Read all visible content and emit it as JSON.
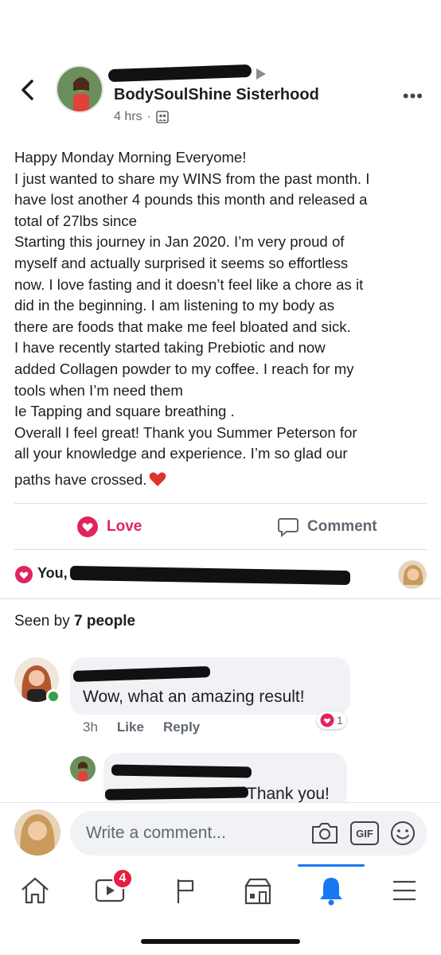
{
  "header": {
    "group_name": "BodySoulShine Sisterhood",
    "time": "4 hrs",
    "separator": "·"
  },
  "post": {
    "lines": [
      "Happy Monday Morning Everyome!",
      "I just wanted to share my WINS from the past month. I",
      "have lost another 4 pounds this month and released a",
      "total of 27lbs since",
      "Starting this journey in Jan 2020. I’m very proud of",
      "myself and actually surprised it seems so effortless",
      "now. I love fasting and it doesn’t feel like a chore as it",
      "did in the beginning. I am listening to my body as",
      "there are foods that make me feel bloated and sick.",
      "I have recently started taking Prebiotic and now",
      "added  Collagen powder to my coffee. I reach for my",
      "tools when I’m need them",
      "Ie Tapping and square breathing .",
      "Overall I feel great! Thank you Summer Peterson for",
      "all your knowledge and experience.  I’m so glad our",
      "paths have crossed."
    ]
  },
  "actions": {
    "love_label": "Love",
    "comment_label": "Comment"
  },
  "reactions": {
    "you_label": "You,"
  },
  "seen": {
    "prefix": "Seen by ",
    "count": "7 people"
  },
  "comments": [
    {
      "text": "Wow, what an amazing result!",
      "time": "3h",
      "like_label": "Like",
      "reply_label": "Reply",
      "reaction_count": "1"
    },
    {
      "text": "Thank you!"
    }
  ],
  "composer": {
    "placeholder": "Write a comment...",
    "gif_label": "GIF"
  },
  "tabbar": {
    "badge_count": "4",
    "active_tab": "notifications"
  },
  "colors": {
    "love": "#e0245e",
    "accent": "#1877f2",
    "online": "#31a24c",
    "badge": "#e41e3f"
  }
}
